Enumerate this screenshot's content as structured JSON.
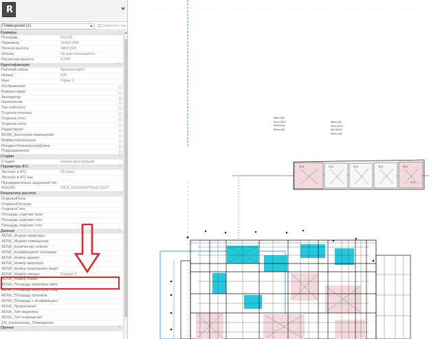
{
  "app": {
    "logo_letter": "R"
  },
  "filter": {
    "selected": "Помещения (1)",
    "edit_type_label": "Изменить тип"
  },
  "groups": [
    {
      "title": "Размеры",
      "rows": [
        {
          "label": "Площадь",
          "value": "54,318"
        },
        {
          "label": "Периметр",
          "value": "31840,000"
        },
        {
          "label": "Полная высота",
          "value": "4800,000"
        },
        {
          "label": "Объем",
          "value": "Не рассчитывается"
        },
        {
          "label": "Расчетная высота",
          "value": "0,000"
        }
      ]
    },
    {
      "title": "Идентификация",
      "rows": [
        {
          "label": "Рабочий набор",
          "value": "Архитектор01"
        },
        {
          "label": "Номер",
          "value": "628"
        },
        {
          "label": "Имя",
          "value": "Офис 2"
        },
        {
          "label": "Изображение",
          "value": ""
        },
        {
          "label": "Комментарии",
          "value": ""
        },
        {
          "label": "Арендатор",
          "value": ""
        },
        {
          "label": "Назначение",
          "value": ""
        },
        {
          "label": "Тип плинтуса",
          "value": ""
        },
        {
          "label": "Отделка потолка",
          "value": ""
        },
        {
          "label": "Отделка стен",
          "value": ""
        },
        {
          "label": "Отделка пола",
          "value": ""
        },
        {
          "label": "Редактирует",
          "value": ""
        },
        {
          "label": "ADSK_Категория помещения",
          "value": ""
        },
        {
          "label": "МоldинтНачальные",
          "value": ""
        },
        {
          "label": "МолдингтНачальныеДлина",
          "value": ""
        },
        {
          "label": "Подразделение",
          "value": ""
        }
      ]
    },
    {
      "title": "Стадии",
      "rows": [
        {
          "label": "Стадия",
          "value": "Новая конструкция"
        }
      ]
    },
    {
      "title": "Параметры IFC",
      "rows": [
        {
          "label": "Экспорт в IFC",
          "value": "По типу"
        },
        {
          "label": "Экспорт в IFC как",
          "value": ""
        },
        {
          "label": "Предварительно заданный тип I...",
          "value": ""
        },
        {
          "label": "IfcGUID",
          "value": "33L9_SXZsDshPTkxrCZuZ7"
        }
      ]
    },
    {
      "title": "Результаты расчета",
      "rows": [
        {
          "label": "ОтделкаПола",
          "value": ""
        },
        {
          "label": "ОтделкаПотолка",
          "value": ""
        },
        {
          "label": "ОтделкаСтен",
          "value": ""
        },
        {
          "label": "Площадь отделки пола",
          "value": ""
        },
        {
          "label": "Площадь отделки стен",
          "value": ""
        },
        {
          "label": "Площадь отделки стен",
          "value": ""
        }
      ]
    },
    {
      "title": "Данные",
      "rows": [
        {
          "label": "ADSK_Индекс квартиры",
          "value": ""
        },
        {
          "label": "ADSK_Индекс помещения",
          "value": ""
        },
        {
          "label": "ADSK_Количество комнат",
          "value": ""
        },
        {
          "label": "ADSK_Коэффициент площади",
          "value": ""
        },
        {
          "label": "ADSK_Номер здания",
          "value": ""
        },
        {
          "label": "ADSK_Номер квартиры",
          "value": ""
        },
        {
          "label": "ADSK_Номер помещения квартир",
          "value": ""
        },
        {
          "label": "ADSK_Номер секции",
          "value": "Секция 2"
        },
        {
          "label": "ADSK_Номер этажа",
          "value": ""
        },
        {
          "label": "ADSK_Площадь квартиры жилая",
          "value": ""
        },
        {
          "label": "ADSK_Площадь квартиры общая",
          "value": ""
        },
        {
          "label": "ADSK_Площадь проемов",
          "value": ""
        },
        {
          "label": "ADSK_Площадь с коэффициент...",
          "value": ""
        },
        {
          "label": "ADSK_Примечание",
          "value": ""
        },
        {
          "label": "ADSK_Тип квартиры",
          "value": ""
        },
        {
          "label": "ADSK_Тип помещения",
          "value": ""
        },
        {
          "label": "ZH_Назначение_Помещения",
          "value": ""
        }
      ]
    },
    {
      "title": "Прочее",
      "rows": []
    }
  ],
  "highlighted_parameter": "ADSK_Номер секции",
  "annotation": {
    "color": "#e0262a"
  },
  "drawing": {
    "tags_left": [
      "Nfax=4,50",
      "Smin=39,27",
      "Sn5=6n,6n",
      "Smin=n,3n"
    ],
    "tags_right": [
      "Nfax=4,50",
      "Smin=39,27",
      "Sn5=6n,6n",
      "Smin=n,35"
    ],
    "strip_labels": [
      "32,6",
      "33,6",
      "34,6",
      "35,6",
      "36,6",
      "37,6"
    ],
    "colors": {
      "cyan": "#22c8dc",
      "pink": "#f3d9dd",
      "selection": "#3aa0ff",
      "linework": "#1a1a1a"
    }
  }
}
